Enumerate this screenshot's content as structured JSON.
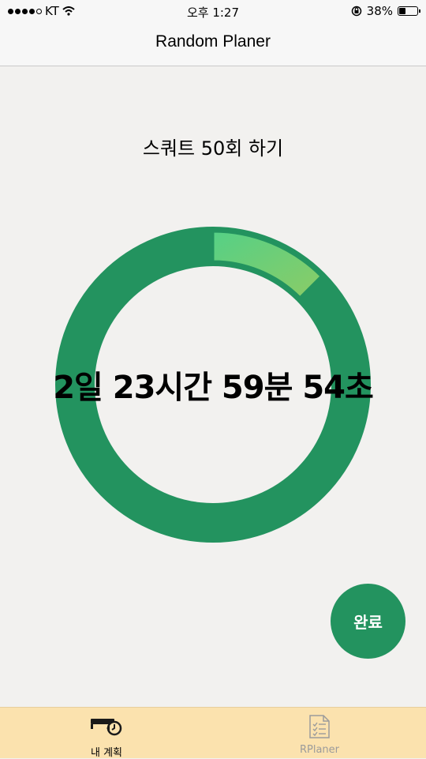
{
  "status_bar": {
    "carrier": "KT",
    "time": "오후 1:27",
    "battery_percent": "38%",
    "battery_level": 0.38
  },
  "nav": {
    "title": "Random Planer"
  },
  "plan": {
    "title": "스쿼트 50회 하기",
    "countdown": "2일 23시간 59분 54초",
    "progress_fraction": 0.125
  },
  "complete_button": {
    "label": "완료"
  },
  "tabs": [
    {
      "label": "내 계획",
      "icon": "bed-clock-icon"
    },
    {
      "label": "RPlaner",
      "icon": "document-list-icon"
    }
  ],
  "colors": {
    "ring": "#23935f",
    "segment_start": "#55d086",
    "segment_end": "#8bcc66",
    "tab_bar": "#fbe2ae"
  }
}
